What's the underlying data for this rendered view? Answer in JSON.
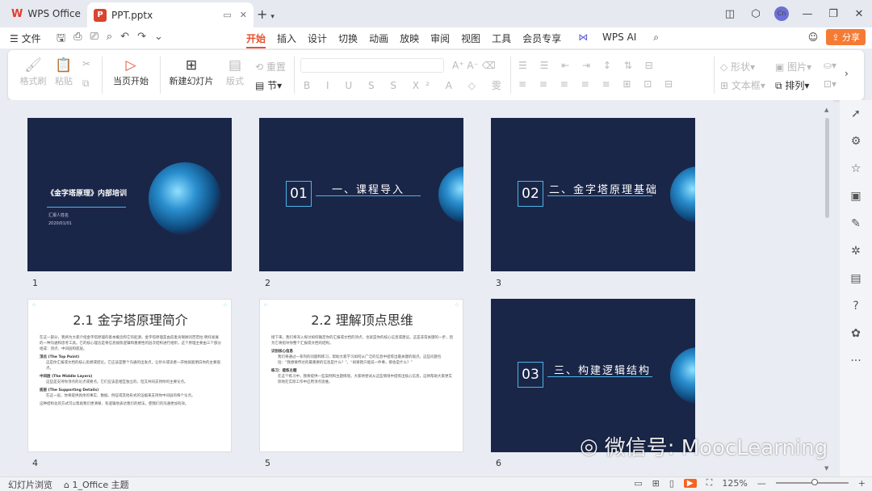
{
  "titlebar": {
    "home_label": "WPS Office",
    "doc_title": "PPT.pptx",
    "avatar_text": "Cn"
  },
  "menu": {
    "file": "文件",
    "tabs": [
      "开始",
      "插入",
      "设计",
      "切换",
      "动画",
      "放映",
      "审阅",
      "视图",
      "工具",
      "会员专享"
    ],
    "wps_ai": "WPS AI",
    "share": "分享"
  },
  "ribbon": {
    "format_painter": "格式刷",
    "paste": "粘贴",
    "start_from": "当页开始",
    "new_slide": "新建幻灯片",
    "layout": "版式",
    "section": "节",
    "reset": "重置",
    "shape": "形状",
    "picture": "图片",
    "textbox": "文本框",
    "arrange": "排列"
  },
  "slides": [
    {
      "number": "1",
      "title": "《金字塔原理》内部培训",
      "reporter": "汇报人姓名",
      "date": "2020/01/01"
    },
    {
      "number": "2",
      "badge": "01",
      "title": "一、课程导入"
    },
    {
      "number": "3",
      "badge": "02",
      "title": "二、金字塔原理基础"
    },
    {
      "number": "4",
      "title": "2.1 金字塔原理简介",
      "lines": [
        "在这一部分，我将为大家介绍金字塔原理的基本概念和它的起源。金字塔原理是由前麦肯锡顾问芭芭拉·明托发展的一种沟通和思考工具。它的核心理念是将信息按照逻辑和重要性的层次结构进行组织，这个原理主要由三个部分组成：顶点、中间层和底层。",
        "顶点 (The Top Point)",
        "这是你汇报或文档的核心思想或结论。它应该是整个沟通的出发点，让听众或读者一开始就能明白你的主要观点。",
        "中间层 (The Middle Layers)",
        "这些是支持你顶点的论点或要点。它们应该是相互独立的，但又共同支持你的主要论点。",
        "底层 (The Supporting Details)",
        "在这一层，你将提供具体的事实、数据、例证或其他形式的证据来支持你中间层的每个论点。",
        "这种结构化的方式可以帮助我们更清晰、有逻辑地表达我们的想法，使我们的沟通更加有效。"
      ]
    },
    {
      "number": "5",
      "title": "2.2 理解顶点思维",
      "lines": [
        "接下来，我们将深入探讨如何确定你的汇报或文档的顶点，也就是你的核心信息或建议。这是非常关键的一步，因为它将指导你整个汇报或文档的结构。",
        "识别核心信息",
        "我们将通过一系列的问题和练习，帮助大家学习如何从广泛的信息中提炼出最关键的观点。这些问题包括：“我想要传达的最重要的信息是什么？”，“如果我只能说一件事，那会是什么？”",
        "练习：提炼主题",
        "在这个练习中，我将提供一些案例和主题情境。大家将尝试从这些情境中提炼出核心信息，这将帮助大家更实际地在实际工作中应用顶点思维。"
      ]
    },
    {
      "number": "6",
      "badge": "03",
      "title": "三、构建逻辑结构"
    }
  ],
  "statusbar": {
    "view": "幻灯片浏览",
    "theme": "1_Office 主题",
    "zoom": "125%",
    "zoom_level": 0.5
  },
  "watermark": "微信号: MoocLearning",
  "colors": {
    "accent": "#e8502f",
    "slide_dark": "#1a2648",
    "line": "#4cb4e6",
    "share": "#f57b35"
  }
}
